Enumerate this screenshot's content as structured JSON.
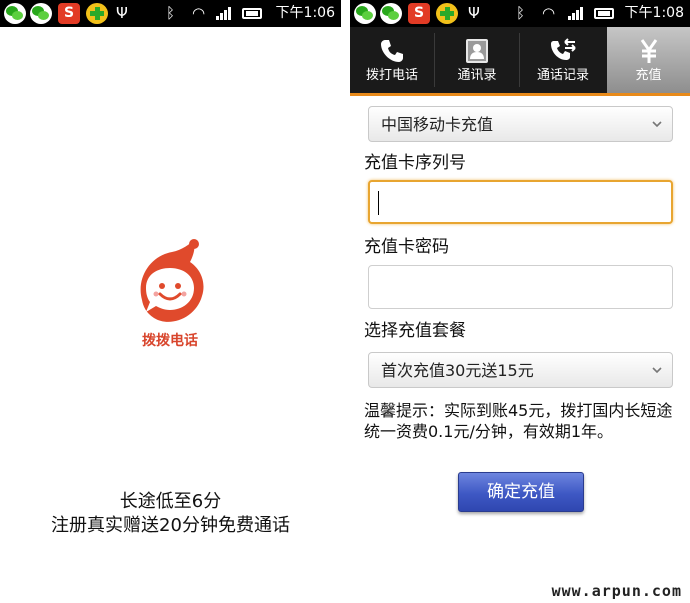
{
  "status_bar": {
    "left_time": "下午1:06",
    "right_time": "下午1:08",
    "sogou_glyph": "S",
    "usb_glyph": "Ψ",
    "bluetooth_glyph": "ᛒ",
    "wifi_glyph": "◠"
  },
  "splash": {
    "logo_text": "拨拨电话",
    "slogan_line1": "长途低至6分",
    "slogan_line2": "注册真实赠送20分钟免费通话",
    "brand_color": "#e04a2c"
  },
  "tabs": [
    {
      "label": "拨打电话",
      "icon": "phone-icon",
      "active": false
    },
    {
      "label": "通讯录",
      "icon": "contacts-icon",
      "active": false
    },
    {
      "label": "通话记录",
      "icon": "call-log-icon",
      "active": false
    },
    {
      "label": "充值",
      "icon": "yuan-icon",
      "active": true
    }
  ],
  "recharge": {
    "carrier_selected": "中国移动卡充值",
    "serial_label": "充值卡序列号",
    "serial_value": "",
    "password_label": "充值卡密码",
    "password_value": "",
    "package_label": "选择充值套餐",
    "package_selected": "首次充值30元送15元",
    "tip_text": "温馨提示：实际到账45元，拨打国内长短途统一资费0.1元/分钟，有效期1年。",
    "confirm_label": "确定充值",
    "focus_color": "#e8a530",
    "button_color": "#3e58c4"
  },
  "watermark": "www.arpun.com"
}
